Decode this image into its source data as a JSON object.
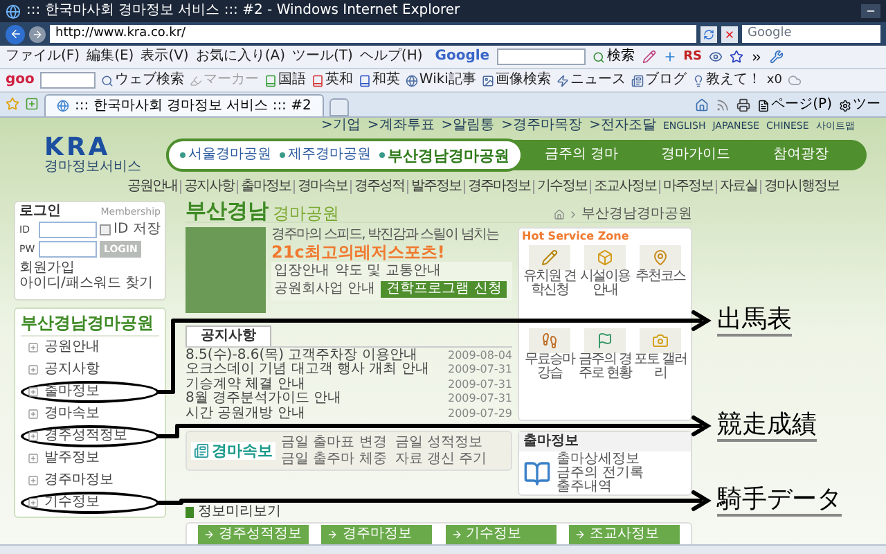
{
  "window": {
    "title": "::: 한국마사회 경마정보 서비스 ::: #2 - Windows Internet Explorer"
  },
  "address_bar": {
    "url": "http://www.kra.co.kr/",
    "search_placeholder": "Google"
  },
  "menu_bar": [
    "ファイル(F)",
    "編集(E)",
    "表示(V)",
    "お気に入り(A)",
    "ツール(T)",
    "ヘルプ(H)"
  ],
  "google_toolbar": {
    "logo": "Google",
    "search_button": "検索",
    "rs_label": "RS"
  },
  "goo_toolbar": {
    "logo": "goo",
    "counter": "x0",
    "items": [
      {
        "kind": "search",
        "label": "ウェブ検索",
        "disabled": false
      },
      {
        "kind": "marker",
        "label": "マーカー",
        "disabled": true
      },
      {
        "kind": "dict",
        "label": "国語",
        "disabled": false,
        "color": "#2e9a2e"
      },
      {
        "kind": "dict",
        "label": "英和",
        "disabled": false,
        "color": "#d42a2a"
      },
      {
        "kind": "dict",
        "label": "和英",
        "disabled": false,
        "color": "#2a52c4"
      },
      {
        "kind": "wiki",
        "label": "Wiki記事",
        "disabled": false
      },
      {
        "kind": "image",
        "label": "画像検索",
        "disabled": false
      },
      {
        "kind": "news",
        "label": "ニュース",
        "disabled": false
      },
      {
        "kind": "blog",
        "label": "ブログ",
        "disabled": false
      },
      {
        "kind": "ask",
        "label": "教えて！",
        "disabled": false
      }
    ]
  },
  "tabs": [
    {
      "label": "::: 한국마사회 경마정보 서비스 ::: #2",
      "selected": true
    }
  ],
  "command_bar": {
    "page_menu": "ページ(P)",
    "tools_menu": "ツー"
  },
  "page": {
    "top_links": [
      ">기업",
      ">계좌투표",
      ">알림통",
      ">경주마목장",
      ">전자조달"
    ],
    "languages": [
      "ENGLISH",
      "JAPANESE",
      "CHINESE",
      "사이트맵"
    ],
    "logo": {
      "mark": "KRA",
      "subtitle": "경마정보서비스"
    },
    "parks": [
      {
        "label": "서울경마공원",
        "selected": false
      },
      {
        "label": "제주경마공원",
        "selected": false
      },
      {
        "label": "부산경남경마공원",
        "selected": true
      }
    ],
    "main_nav": [
      "금주의 경마",
      "경마가이드",
      "참여광장"
    ],
    "sub_nav": [
      "공원안내",
      "공지사항",
      "출마정보",
      "경마속보",
      "경주성적",
      "발주정보",
      "경주마정보",
      "기수정보",
      "조교사정보",
      "마주정보",
      "자료실",
      "경마시행정보"
    ],
    "login": {
      "title": "로그인",
      "membership": "Membership",
      "id_label": "ID",
      "save_id": "ID 저장",
      "save_id_checked": false,
      "pw_label": "PW",
      "login_button": "LOGIN",
      "links": [
        "회원가입",
        "아이디/패스워드 찾기"
      ]
    },
    "sidebar": {
      "title": "부산경남경마공원",
      "items": [
        {
          "label": "공원안내",
          "circled": false
        },
        {
          "label": "공지사항",
          "circled": false
        },
        {
          "label": "출마정보",
          "circled": true
        },
        {
          "label": "경마속보",
          "circled": false
        },
        {
          "label": "경주성적정보",
          "circled": true
        },
        {
          "label": "발주정보",
          "circled": false
        },
        {
          "label": "경주마정보",
          "circled": false
        },
        {
          "label": "기수정보",
          "circled": true
        }
      ]
    },
    "heading": {
      "main": "부산경남",
      "sub": "경마공원"
    },
    "breadcrumb": "부산경남경마공원",
    "promo": {
      "tagline": "경주마의 스피드, 박진감과 스릴이 넘치는",
      "slogan": "21c최고의레저스포츠!",
      "links": [
        "입장안내",
        "약도 및 교통안내",
        "공원회사업 안내"
      ],
      "button": "견학프로그램 신청"
    },
    "notice_tabs": [
      {
        "label": "공지사항",
        "selected": true
      }
    ],
    "notices": [
      {
        "title": "8.5(수)-8.6(목) 고객주차장 이용안내",
        "date": "2009-08-04"
      },
      {
        "title": "오크스데이 기념 대고객 행사 개최 안내",
        "date": "2009-07-31"
      },
      {
        "title": "기승계약 체결 안내",
        "date": "2009-07-31"
      },
      {
        "title": "8월 경주분석가이드 안내",
        "date": "2009-07-31"
      },
      {
        "title": "시간 공원개방 안내",
        "date": "2009-07-29"
      }
    ],
    "quick_news": {
      "title": "경마속보",
      "items": [
        "금일 출마표 변경",
        "금일 성적정보",
        "금일 출주마 체중",
        "자료 갱신 주기"
      ]
    },
    "hot_zone": {
      "title": "Hot Service Zone",
      "tiles": [
        {
          "kind": "tour",
          "label": "유치원 견학신청"
        },
        {
          "kind": "facility",
          "label": "시설이용 안내"
        },
        {
          "kind": "course",
          "label": "추천코스"
        },
        {
          "kind": "riding",
          "label": "무료승마 강습"
        },
        {
          "kind": "track",
          "label": "금주의 경주로 현황"
        },
        {
          "kind": "photo",
          "label": "포토 갤러리"
        }
      ]
    },
    "entry_box": {
      "title": "출마정보",
      "links": [
        "출마상세정보",
        "금주의 전기록",
        "출주내역"
      ]
    },
    "preview": {
      "title": "정보미리보기",
      "buttons": [
        "경주성적정보",
        "경주마정보",
        "기수정보",
        "조교사정보"
      ]
    },
    "annotations": [
      "出馬表",
      "競走成績",
      "騎手データ"
    ]
  }
}
